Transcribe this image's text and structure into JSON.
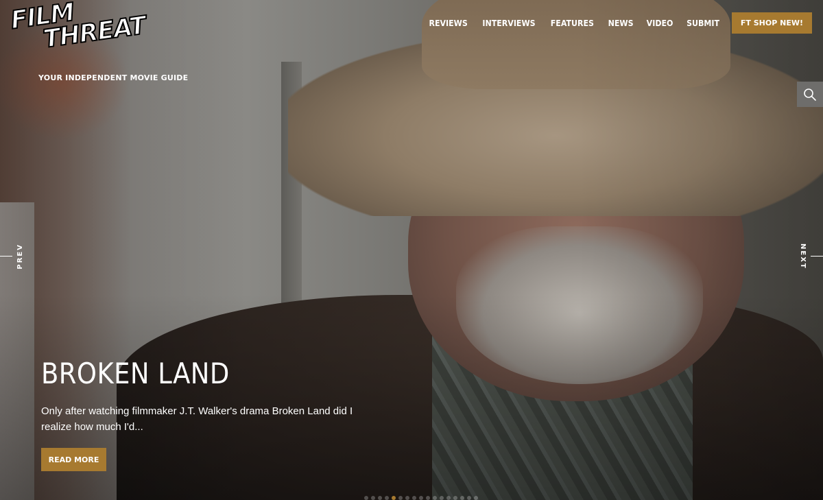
{
  "brand": {
    "logo_line1": "FILM",
    "logo_line2": "THREAT",
    "tagline": "YOUR INDEPENDENT MOVIE GUIDE"
  },
  "nav": {
    "items": [
      {
        "label": "REVIEWS"
      },
      {
        "label": "INTERVIEWS"
      },
      {
        "label": "FEATURES"
      },
      {
        "label": "NEWS"
      },
      {
        "label": "VIDEO"
      },
      {
        "label": "SUBMIT"
      }
    ],
    "shop_label": "FT SHOP NEW!"
  },
  "search": {
    "icon": "search-icon"
  },
  "slider": {
    "prev_label": "PREV",
    "next_label": "NEXT",
    "title": "BROKEN LAND",
    "excerpt": "Only after watching filmmaker J.T. Walker's drama Broken Land did I realize how much I'd...",
    "read_more_label": "READ MORE",
    "dot_count": 17,
    "active_dot": 4
  },
  "colors": {
    "accent": "#a77a30",
    "search_bg": "#6e6d6b"
  }
}
